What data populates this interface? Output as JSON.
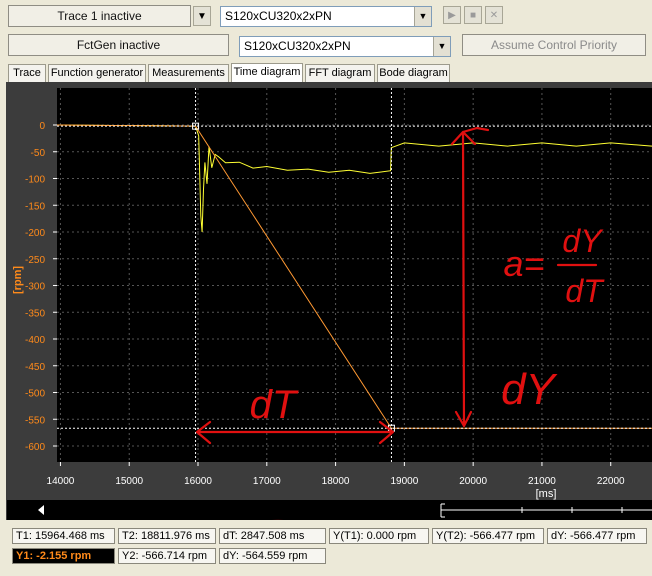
{
  "toolbar": {
    "trace_button": "Trace 1 inactive",
    "trace_device": "S120xCU320x2xPN",
    "fctgen_button": "FctGen  inactive",
    "fctgen_device": "S120xCU320x2xPN",
    "assume_control": "Assume Control Priority"
  },
  "tabs": [
    "Trace",
    "Function generator",
    "Measurements",
    "Time diagram",
    "FFT diagram",
    "Bode diagram"
  ],
  "active_tab": "Time diagram",
  "chart_data": {
    "type": "line",
    "ylabel": "[rpm]",
    "xlabel": "[ms]",
    "ylim": [
      -610,
      10
    ],
    "xlim": [
      13950,
      22600
    ],
    "yticks": [
      0,
      -50,
      -100,
      -150,
      -200,
      -250,
      -300,
      -350,
      -400,
      -450,
      -500,
      -550,
      -600
    ],
    "xticks": [
      14000,
      15000,
      16000,
      17000,
      18000,
      19000,
      20000,
      21000,
      22000
    ],
    "grid": true,
    "series": [
      {
        "color": "#ffff33",
        "points": [
          [
            13950,
            0
          ],
          [
            15964,
            -2
          ],
          [
            16010,
            -20
          ],
          [
            16040,
            -170
          ],
          [
            16060,
            -200
          ],
          [
            16080,
            -120
          ],
          [
            16100,
            -70
          ],
          [
            16130,
            -110
          ],
          [
            16160,
            -40
          ],
          [
            16200,
            -80
          ],
          [
            16250,
            -55
          ],
          [
            16300,
            -62
          ],
          [
            16400,
            -68
          ],
          [
            16600,
            -72
          ],
          [
            16800,
            -78
          ],
          [
            17000,
            -80
          ],
          [
            17300,
            -82
          ],
          [
            17600,
            -85
          ],
          [
            17900,
            -86
          ],
          [
            18200,
            -87
          ],
          [
            18500,
            -88
          ],
          [
            18800,
            -88
          ],
          [
            18810,
            -40
          ],
          [
            19000,
            -36
          ],
          [
            19500,
            -37
          ],
          [
            20000,
            -36
          ],
          [
            20500,
            -37
          ],
          [
            21000,
            -36
          ],
          [
            21500,
            -37
          ],
          [
            22000,
            -36
          ],
          [
            22600,
            -37
          ]
        ]
      },
      {
        "color": "#ff9933",
        "points": [
          [
            13950,
            0
          ],
          [
            15964,
            -2
          ],
          [
            18812,
            -567
          ],
          [
            22600,
            -567
          ]
        ]
      }
    ],
    "cursors": {
      "t1": 15964.468,
      "t2": 18811.976,
      "y1": -2.155,
      "y2": -566.714
    }
  },
  "annotations": {
    "dT": "dT",
    "dY": "dY",
    "formula_a": "a=",
    "formula_num": "dY",
    "formula_den": "dT"
  },
  "status": {
    "t1": "T1: 15964.468 ms",
    "t2": "T2: 18811.976 ms",
    "dt": "dT: 2847.508 ms",
    "y_t1": "Y(T1):  0.000 rpm",
    "y_t2": "Y(T2): -566.477 rpm",
    "dy_right": "dY: -566.477 rpm",
    "y1": "Y1: -2.155 rpm",
    "y2": "Y2: -566.714 rpm",
    "dy": "dY: -564.559 rpm"
  }
}
